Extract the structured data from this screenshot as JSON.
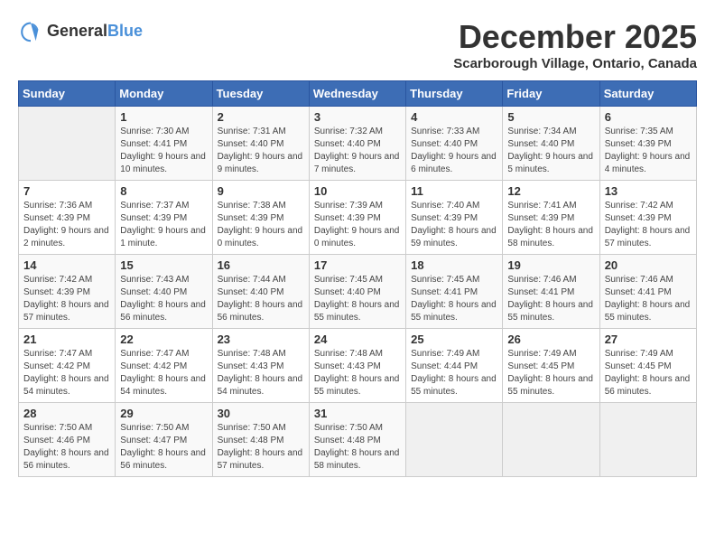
{
  "logo": {
    "text_general": "General",
    "text_blue": "Blue"
  },
  "title": {
    "month": "December 2025",
    "location": "Scarborough Village, Ontario, Canada"
  },
  "calendar": {
    "headers": [
      "Sunday",
      "Monday",
      "Tuesday",
      "Wednesday",
      "Thursday",
      "Friday",
      "Saturday"
    ],
    "weeks": [
      [
        {
          "day": "",
          "sunrise": "",
          "sunset": "",
          "daylight": ""
        },
        {
          "day": "1",
          "sunrise": "Sunrise: 7:30 AM",
          "sunset": "Sunset: 4:41 PM",
          "daylight": "Daylight: 9 hours and 10 minutes."
        },
        {
          "day": "2",
          "sunrise": "Sunrise: 7:31 AM",
          "sunset": "Sunset: 4:40 PM",
          "daylight": "Daylight: 9 hours and 9 minutes."
        },
        {
          "day": "3",
          "sunrise": "Sunrise: 7:32 AM",
          "sunset": "Sunset: 4:40 PM",
          "daylight": "Daylight: 9 hours and 7 minutes."
        },
        {
          "day": "4",
          "sunrise": "Sunrise: 7:33 AM",
          "sunset": "Sunset: 4:40 PM",
          "daylight": "Daylight: 9 hours and 6 minutes."
        },
        {
          "day": "5",
          "sunrise": "Sunrise: 7:34 AM",
          "sunset": "Sunset: 4:40 PM",
          "daylight": "Daylight: 9 hours and 5 minutes."
        },
        {
          "day": "6",
          "sunrise": "Sunrise: 7:35 AM",
          "sunset": "Sunset: 4:39 PM",
          "daylight": "Daylight: 9 hours and 4 minutes."
        }
      ],
      [
        {
          "day": "7",
          "sunrise": "Sunrise: 7:36 AM",
          "sunset": "Sunset: 4:39 PM",
          "daylight": "Daylight: 9 hours and 2 minutes."
        },
        {
          "day": "8",
          "sunrise": "Sunrise: 7:37 AM",
          "sunset": "Sunset: 4:39 PM",
          "daylight": "Daylight: 9 hours and 1 minute."
        },
        {
          "day": "9",
          "sunrise": "Sunrise: 7:38 AM",
          "sunset": "Sunset: 4:39 PM",
          "daylight": "Daylight: 9 hours and 0 minutes."
        },
        {
          "day": "10",
          "sunrise": "Sunrise: 7:39 AM",
          "sunset": "Sunset: 4:39 PM",
          "daylight": "Daylight: 9 hours and 0 minutes."
        },
        {
          "day": "11",
          "sunrise": "Sunrise: 7:40 AM",
          "sunset": "Sunset: 4:39 PM",
          "daylight": "Daylight: 8 hours and 59 minutes."
        },
        {
          "day": "12",
          "sunrise": "Sunrise: 7:41 AM",
          "sunset": "Sunset: 4:39 PM",
          "daylight": "Daylight: 8 hours and 58 minutes."
        },
        {
          "day": "13",
          "sunrise": "Sunrise: 7:42 AM",
          "sunset": "Sunset: 4:39 PM",
          "daylight": "Daylight: 8 hours and 57 minutes."
        }
      ],
      [
        {
          "day": "14",
          "sunrise": "Sunrise: 7:42 AM",
          "sunset": "Sunset: 4:39 PM",
          "daylight": "Daylight: 8 hours and 57 minutes."
        },
        {
          "day": "15",
          "sunrise": "Sunrise: 7:43 AM",
          "sunset": "Sunset: 4:40 PM",
          "daylight": "Daylight: 8 hours and 56 minutes."
        },
        {
          "day": "16",
          "sunrise": "Sunrise: 7:44 AM",
          "sunset": "Sunset: 4:40 PM",
          "daylight": "Daylight: 8 hours and 56 minutes."
        },
        {
          "day": "17",
          "sunrise": "Sunrise: 7:45 AM",
          "sunset": "Sunset: 4:40 PM",
          "daylight": "Daylight: 8 hours and 55 minutes."
        },
        {
          "day": "18",
          "sunrise": "Sunrise: 7:45 AM",
          "sunset": "Sunset: 4:41 PM",
          "daylight": "Daylight: 8 hours and 55 minutes."
        },
        {
          "day": "19",
          "sunrise": "Sunrise: 7:46 AM",
          "sunset": "Sunset: 4:41 PM",
          "daylight": "Daylight: 8 hours and 55 minutes."
        },
        {
          "day": "20",
          "sunrise": "Sunrise: 7:46 AM",
          "sunset": "Sunset: 4:41 PM",
          "daylight": "Daylight: 8 hours and 55 minutes."
        }
      ],
      [
        {
          "day": "21",
          "sunrise": "Sunrise: 7:47 AM",
          "sunset": "Sunset: 4:42 PM",
          "daylight": "Daylight: 8 hours and 54 minutes."
        },
        {
          "day": "22",
          "sunrise": "Sunrise: 7:47 AM",
          "sunset": "Sunset: 4:42 PM",
          "daylight": "Daylight: 8 hours and 54 minutes."
        },
        {
          "day": "23",
          "sunrise": "Sunrise: 7:48 AM",
          "sunset": "Sunset: 4:43 PM",
          "daylight": "Daylight: 8 hours and 54 minutes."
        },
        {
          "day": "24",
          "sunrise": "Sunrise: 7:48 AM",
          "sunset": "Sunset: 4:43 PM",
          "daylight": "Daylight: 8 hours and 55 minutes."
        },
        {
          "day": "25",
          "sunrise": "Sunrise: 7:49 AM",
          "sunset": "Sunset: 4:44 PM",
          "daylight": "Daylight: 8 hours and 55 minutes."
        },
        {
          "day": "26",
          "sunrise": "Sunrise: 7:49 AM",
          "sunset": "Sunset: 4:45 PM",
          "daylight": "Daylight: 8 hours and 55 minutes."
        },
        {
          "day": "27",
          "sunrise": "Sunrise: 7:49 AM",
          "sunset": "Sunset: 4:45 PM",
          "daylight": "Daylight: 8 hours and 56 minutes."
        }
      ],
      [
        {
          "day": "28",
          "sunrise": "Sunrise: 7:50 AM",
          "sunset": "Sunset: 4:46 PM",
          "daylight": "Daylight: 8 hours and 56 minutes."
        },
        {
          "day": "29",
          "sunrise": "Sunrise: 7:50 AM",
          "sunset": "Sunset: 4:47 PM",
          "daylight": "Daylight: 8 hours and 56 minutes."
        },
        {
          "day": "30",
          "sunrise": "Sunrise: 7:50 AM",
          "sunset": "Sunset: 4:48 PM",
          "daylight": "Daylight: 8 hours and 57 minutes."
        },
        {
          "day": "31",
          "sunrise": "Sunrise: 7:50 AM",
          "sunset": "Sunset: 4:48 PM",
          "daylight": "Daylight: 8 hours and 58 minutes."
        },
        {
          "day": "",
          "sunrise": "",
          "sunset": "",
          "daylight": ""
        },
        {
          "day": "",
          "sunrise": "",
          "sunset": "",
          "daylight": ""
        },
        {
          "day": "",
          "sunrise": "",
          "sunset": "",
          "daylight": ""
        }
      ]
    ]
  }
}
